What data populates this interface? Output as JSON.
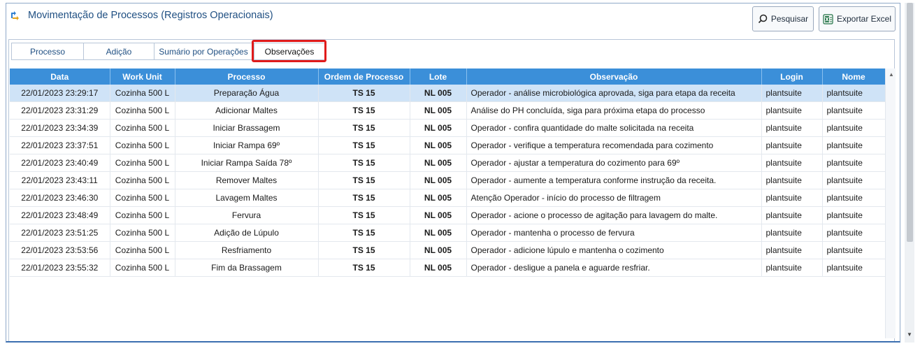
{
  "window": {
    "title": "Movimentação de Processos (Registros Operacionais)",
    "icon": "process-flow-icon",
    "accent": "#1f4f82"
  },
  "toolbar": {
    "search_label": "Pesquisar",
    "search_icon": "search-icon",
    "export_label": "Exportar Excel",
    "export_icon": "excel-icon"
  },
  "tabs": [
    {
      "label": "Processo"
    },
    {
      "label": "Adição"
    },
    {
      "label": "Sumário por Operações"
    },
    {
      "label": "Observações",
      "active": true
    }
  ],
  "table": {
    "header_color": "#3b8fd9",
    "columns": [
      "Data",
      "Work Unit",
      "Processo",
      "Ordem de Processo",
      "Lote",
      "Observação",
      "Login",
      "Nome"
    ],
    "rows": [
      [
        "22/01/2023 23:29:17",
        "Cozinha 500 L",
        "Preparação Água",
        "TS 15",
        "NL 005",
        "Operador - análise microbiológica aprovada, siga para etapa da receita",
        "plantsuite",
        "plantsuite"
      ],
      [
        "22/01/2023 23:31:29",
        "Cozinha 500 L",
        "Adicionar Maltes",
        "TS 15",
        "NL 005",
        "Análise do PH concluída, siga para próxima etapa do processo",
        "plantsuite",
        "plantsuite"
      ],
      [
        "22/01/2023 23:34:39",
        "Cozinha 500 L",
        "Iniciar Brassagem",
        "TS 15",
        "NL 005",
        "Operador - confira quantidade do malte solicitada na receita",
        "plantsuite",
        "plantsuite"
      ],
      [
        "22/01/2023 23:37:51",
        "Cozinha 500 L",
        "Iniciar Rampa 69º",
        "TS 15",
        "NL 005",
        "Operador - verifique a temperatura recomendada para cozimento",
        "plantsuite",
        "plantsuite"
      ],
      [
        "22/01/2023 23:40:49",
        "Cozinha 500 L",
        "Iniciar Rampa Saída 78º",
        "TS 15",
        "NL 005",
        "Operador - ajustar a temperatura do cozimento para 69º",
        "plantsuite",
        "plantsuite"
      ],
      [
        "22/01/2023 23:43:11",
        "Cozinha 500 L",
        "Remover Maltes",
        "TS 15",
        "NL 005",
        "Operador - aumente a temperatura conforme instrução da receita.",
        "plantsuite",
        "plantsuite"
      ],
      [
        "22/01/2023 23:46:30",
        "Cozinha 500 L",
        "Lavagem Maltes",
        "TS 15",
        "NL 005",
        "Atenção Operador - início do processo de filtragem",
        "plantsuite",
        "plantsuite"
      ],
      [
        "22/01/2023 23:48:49",
        "Cozinha 500 L",
        "Fervura",
        "TS 15",
        "NL 005",
        "Operador - acione o processo de agitação para lavagem do malte.",
        "plantsuite",
        "plantsuite"
      ],
      [
        "22/01/2023 23:51:25",
        "Cozinha 500 L",
        "Adição de Lúpulo",
        "TS 15",
        "NL 005",
        "Operador - mantenha o processo de fervura",
        "plantsuite",
        "plantsuite"
      ],
      [
        "22/01/2023 23:53:56",
        "Cozinha 500 L",
        "Resfriamento",
        "TS 15",
        "NL 005",
        "Operador - adicione lúpulo e mantenha o cozimento",
        "plantsuite",
        "plantsuite"
      ],
      [
        "22/01/2023 23:55:32",
        "Cozinha 500 L",
        "Fim da Brassagem",
        "TS 15",
        "NL 005",
        "Operador - desligue a panela e aguarde resfriar.",
        "plantsuite",
        "plantsuite"
      ]
    ],
    "selected_row": 0
  }
}
